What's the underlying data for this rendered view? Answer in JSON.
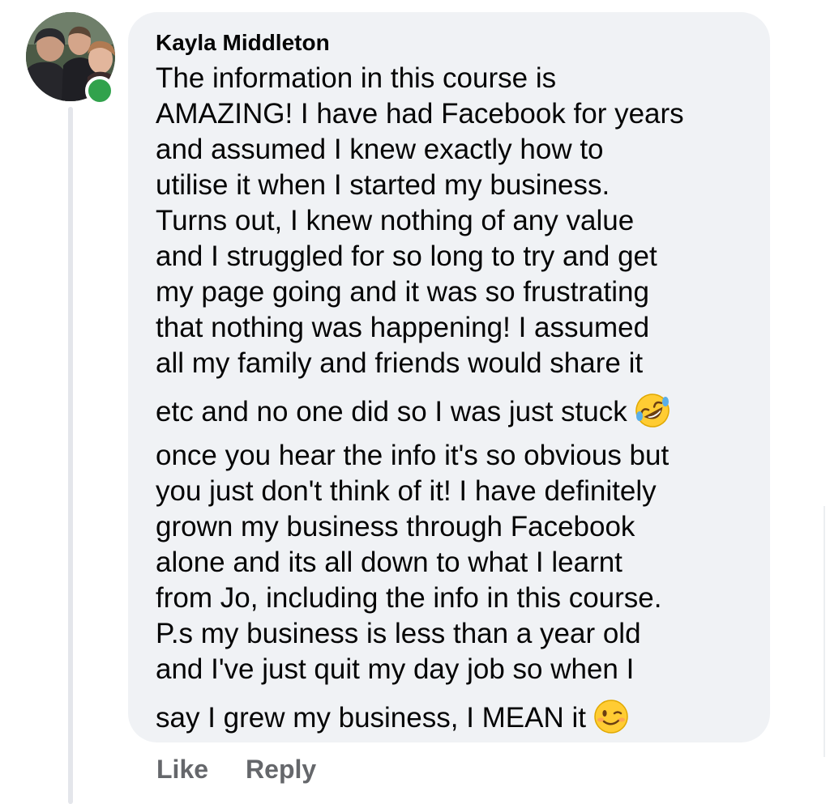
{
  "comment": {
    "author_name": "Kayla Middleton",
    "author_online": true,
    "lines": [
      "The information in this course is",
      "AMAZING! I have had Facebook for years",
      "and assumed I knew exactly how to",
      "utilise it when I started my business.",
      "Turns out, I knew nothing of any value",
      "and I struggled for so long to try and get",
      "my page going and it was so frustrating",
      "that nothing was happening! I assumed",
      "all my family and friends would share it",
      "etc and no one did so I was just stuck",
      "once you hear the info it's so obvious but",
      "you just don't think of it! I have definitely",
      "grown my business through Facebook",
      "alone and its all down to what I learnt",
      "from Jo, including the info in this course.",
      "P.s my business is less than a year old",
      "and I've just quit my day job so when I",
      "say I grew my business, I MEAN it"
    ],
    "emojis": {
      "line_10": "rolling-on-floor-laughing-emoji",
      "line_18": "winking-face-emoji"
    }
  },
  "actions": {
    "like_label": "Like",
    "reply_label": "Reply"
  },
  "colors": {
    "bubble_bg": "#f0f2f5",
    "action_text": "#65676b",
    "online_green": "#31a24c",
    "thread_line": "#e4e6eb"
  }
}
